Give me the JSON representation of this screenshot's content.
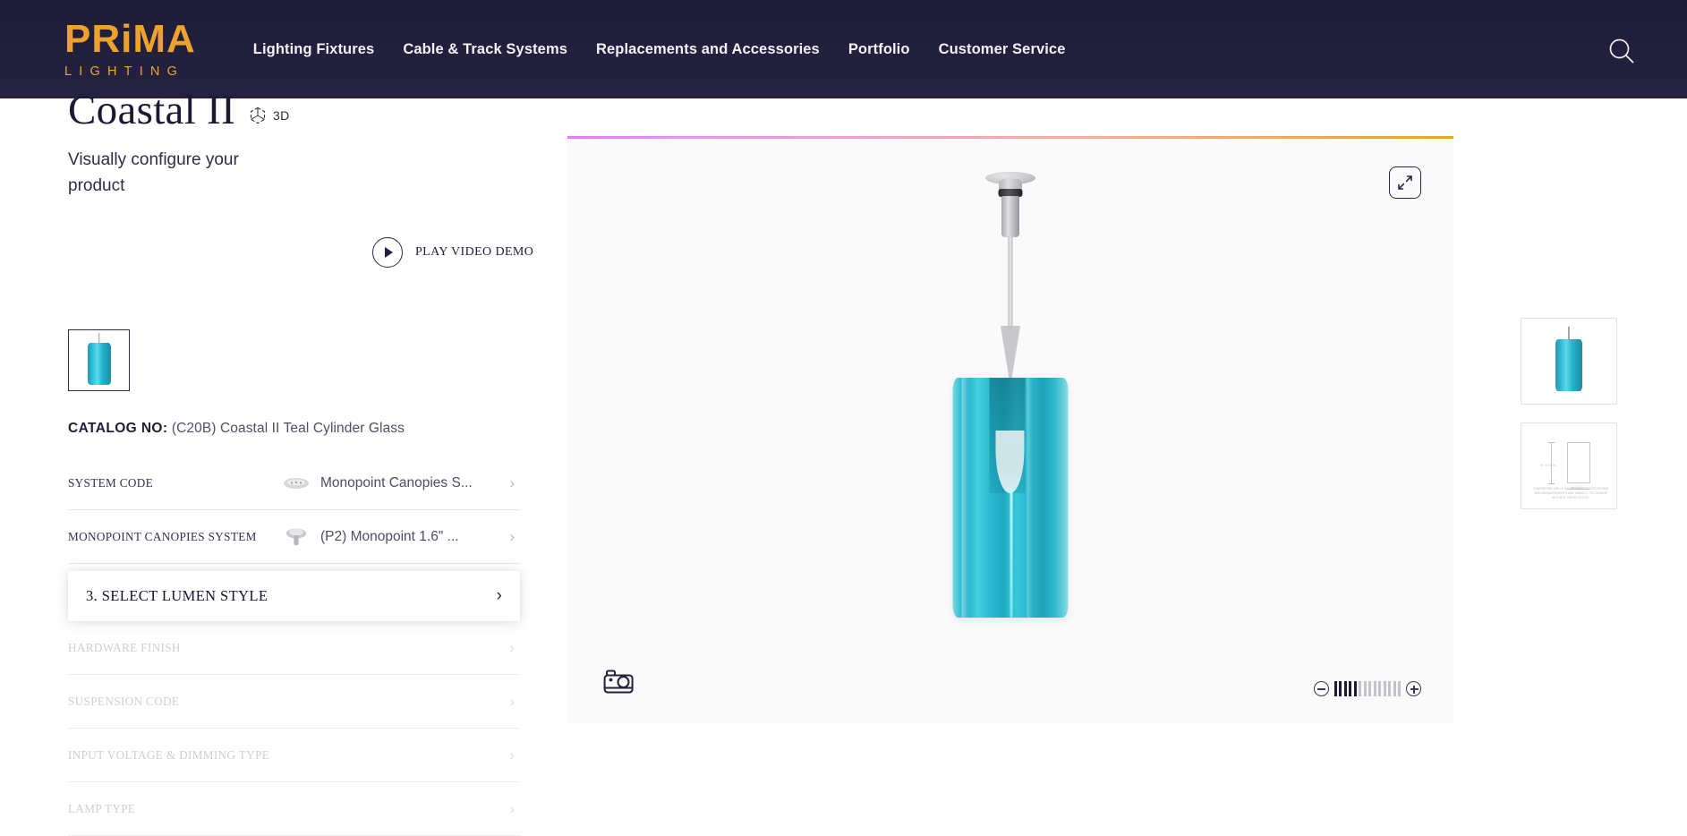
{
  "header": {
    "logo_main": "PRiMA",
    "logo_sub": "LIGHTING",
    "nav": [
      {
        "label": "Lighting Fixtures"
      },
      {
        "label": "Cable & Track Systems"
      },
      {
        "label": "Replacements and Accessories"
      },
      {
        "label": "Portfolio"
      },
      {
        "label": "Customer Service"
      }
    ],
    "search_icon": "search-icon"
  },
  "product": {
    "title": "Coastal II",
    "badge_3d": "3D",
    "badge_3d_icon": "cube-3d-icon",
    "subtitle": "Visually configure your product",
    "play_label": "PLAY VIDEO DEMO",
    "play_icon": "play-circle-icon",
    "catalog_label": "CATALOG NO:",
    "catalog_value": "(C20B) Coastal II Teal Cylinder Glass",
    "swatch_name": "Coastal II Teal Cylinder Glass"
  },
  "options": [
    {
      "label": "SYSTEM CODE",
      "value": "Monopoint Canopies S...",
      "icon": "canopy-plate-icon"
    },
    {
      "label": "MONOPOINT CANOPIES SYSTEM",
      "value": "(P2) Monopoint 1.6\" ...",
      "icon": "monopoint-canopy-icon"
    }
  ],
  "active_step": {
    "label": "3. SELECT LUMEN STYLE",
    "chevron": "›"
  },
  "disabled_options": [
    {
      "label": "HARDWARE FINISH"
    },
    {
      "label": "SUSPENSION CODE"
    },
    {
      "label": "INPUT VOLTAGE & DIMMING TYPE"
    },
    {
      "label": "LAMP TYPE"
    }
  ],
  "viewer": {
    "expand_icon": "expand-arrows-icon",
    "camera_icon": "camera-icon",
    "zoom_out_icon": "zoom-out-icon",
    "zoom_in_icon": "zoom-in-icon",
    "zoom_bars_total": 14,
    "zoom_bars_filled": 5,
    "gradient_start": "#e17bfb",
    "gradient_end": "#efa121"
  },
  "thumbnails": [
    {
      "name": "product-render-thumbnail",
      "alt": "Coastal II teal cylinder pendant render"
    },
    {
      "name": "technical-drawing-thumbnail",
      "alt": "Dimensional technical drawing"
    }
  ],
  "tech_drawing": {
    "height_dim": "H: 10.5 in",
    "width_dim": "W: 5.0 in",
    "notes": "DIMENSIONS ARE IN INCHES (IN). SPECIFICATIONS AND MEASUREMENTS ARE SUBJECT TO CHANGE WITHOUT PRIOR NOTICE."
  },
  "colors": {
    "header_bg": "#22203c",
    "brand_orange": "#eda22e",
    "ink": "#1c1a33",
    "teal": "#2bb8ce"
  }
}
